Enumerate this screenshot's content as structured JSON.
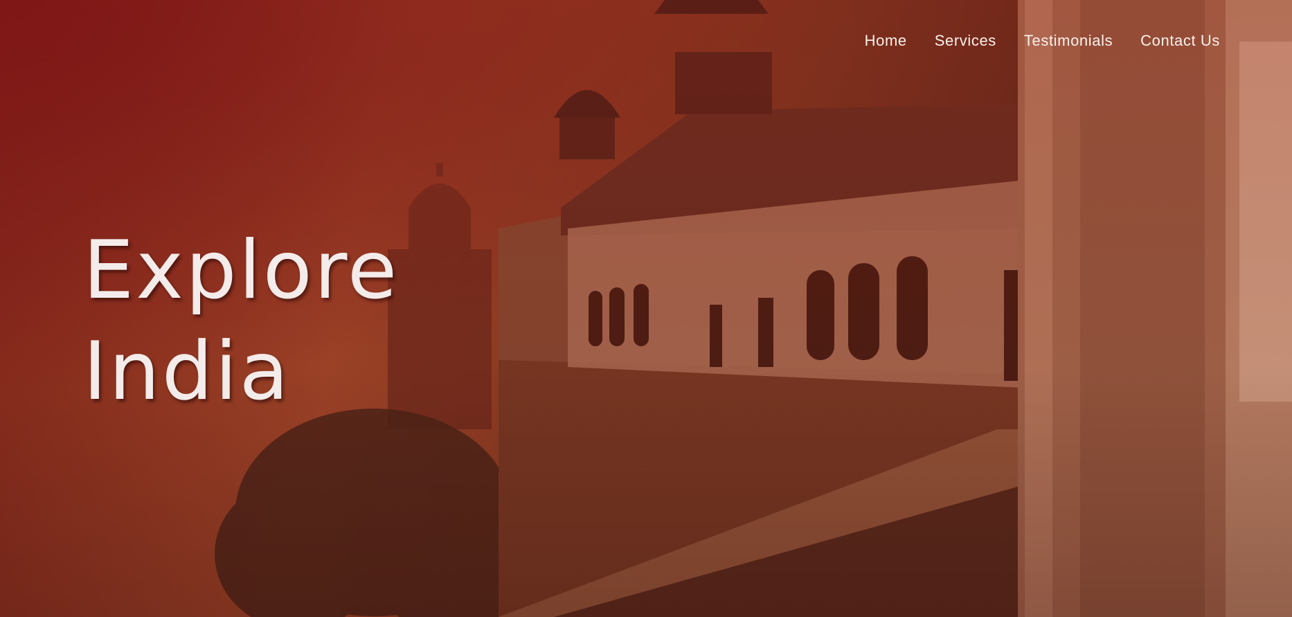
{
  "nav": {
    "items": [
      {
        "label": "Home"
      },
      {
        "label": "Services"
      },
      {
        "label": "Testimonials"
      },
      {
        "label": "Contact Us"
      }
    ]
  },
  "hero": {
    "headline_line1": "Explore",
    "headline_line2": "India",
    "background_image": "fort-palace-balcony-photo",
    "colors": {
      "overlay_red": "#8a1a18",
      "warm_orange": "#a5482a",
      "text": "#f4ecea"
    }
  }
}
